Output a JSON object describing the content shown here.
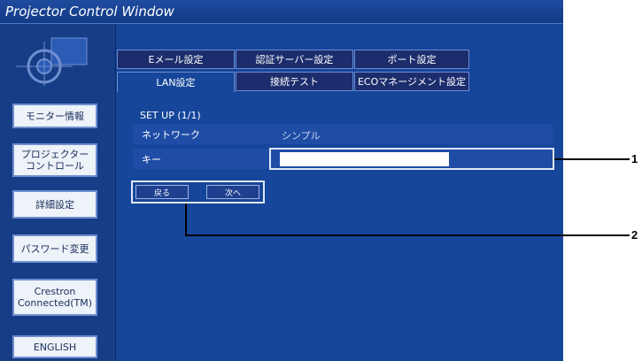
{
  "window": {
    "title": "Projector Control Window"
  },
  "sidebar": {
    "items": [
      {
        "label": "モニター情報"
      },
      {
        "label": "プロジェクター\nコントロール"
      },
      {
        "label": "詳細設定"
      },
      {
        "label": "パスワード変更"
      },
      {
        "label": "Crestron\nConnected(TM)"
      },
      {
        "label": "ENGLISH"
      }
    ]
  },
  "tabs": {
    "email": "Eメール設定",
    "auth": "認証サーバー設定",
    "port": "ポート設定",
    "lan": "LAN設定",
    "conn_test": "接続テスト",
    "eco": "ECOマネージメント設定"
  },
  "form": {
    "setup_label": "SET UP (1/1)",
    "network_label": "ネットワーク",
    "network_value": "シンプル",
    "key_label": "キー",
    "key_value": ""
  },
  "buttons": {
    "back": "戻る",
    "next": "次へ"
  },
  "callouts": {
    "one": "1",
    "two": "2"
  }
}
